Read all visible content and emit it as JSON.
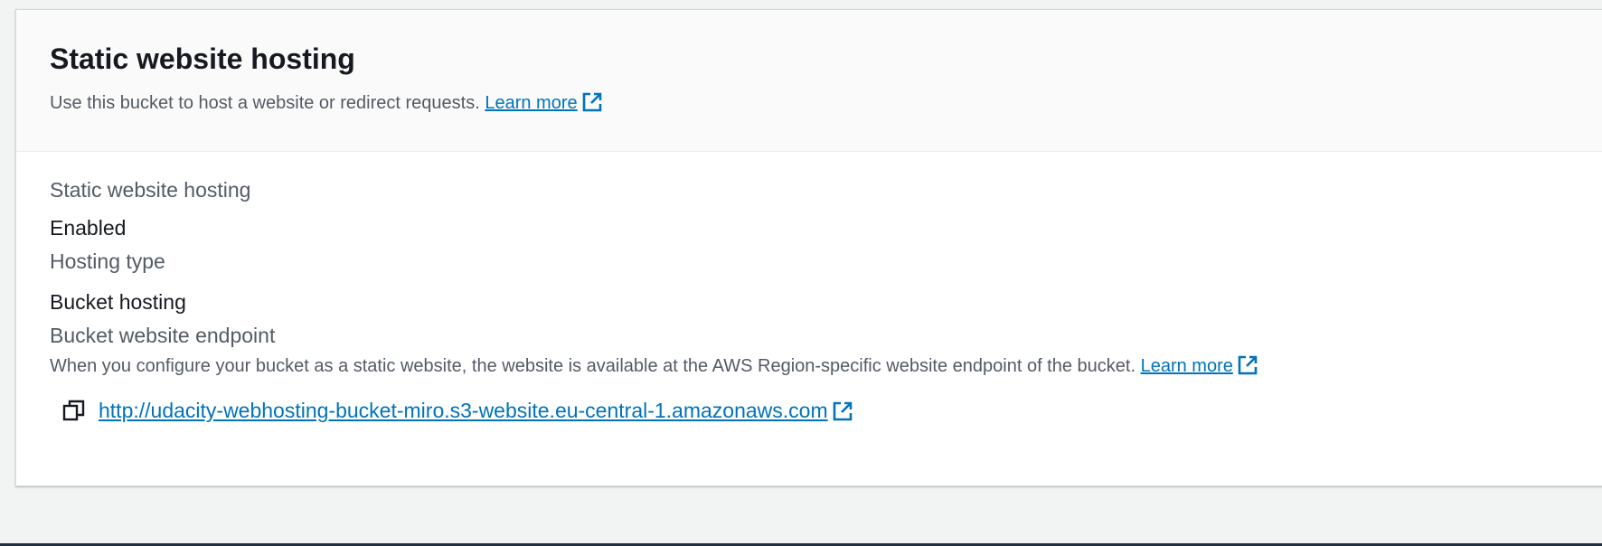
{
  "section": {
    "title": "Static website hosting",
    "description": "Use this bucket to host a website or redirect requests.",
    "learn_more_label": "Learn more"
  },
  "details": {
    "hosting_label": "Static website hosting",
    "hosting_value": "Enabled",
    "type_label": "Hosting type",
    "type_value": "Bucket hosting",
    "endpoint_label": "Bucket website endpoint",
    "endpoint_help": "When you configure your bucket as a static website, the website is available at the AWS Region-specific website endpoint of the bucket.",
    "endpoint_learn_more_label": "Learn more",
    "endpoint_url": "http://udacity-webhosting-bucket-miro.s3-website.eu-central-1.amazonaws.com"
  },
  "icons": {
    "external_link": "external-link-icon",
    "copy": "copy-icon"
  },
  "colors": {
    "link": "#0073bb",
    "heading": "#16191f",
    "secondary_text": "#545b64",
    "page_background": "#f2f3f3",
    "header_background": "#fafafa"
  }
}
